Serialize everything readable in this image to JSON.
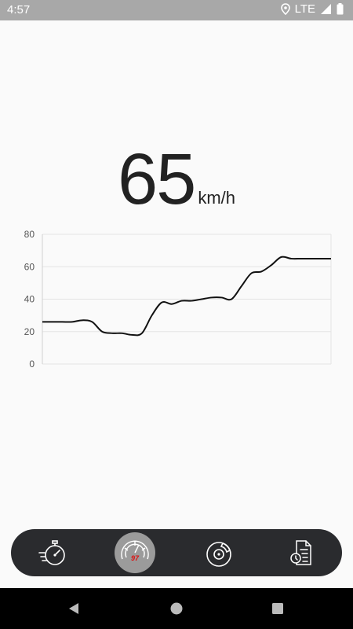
{
  "status_bar": {
    "time": "4:57",
    "network": "LTE"
  },
  "speed": {
    "value": "65",
    "unit": "km/h"
  },
  "chart_data": {
    "type": "line",
    "ylim": [
      0,
      80
    ],
    "yticks": [
      "80",
      "60",
      "40",
      "20",
      "0"
    ],
    "grid": true,
    "series": [
      {
        "values": [
          26,
          26,
          26,
          26,
          27,
          26,
          20,
          19,
          19,
          18,
          19,
          30,
          38,
          37,
          39,
          39,
          40,
          41,
          41,
          40,
          48,
          56,
          57,
          61,
          66,
          65,
          65,
          65,
          65,
          65
        ]
      }
    ],
    "line_color": "#111111"
  },
  "bottom_nav": {
    "gauge_badge": "97",
    "items": [
      "stopwatch-icon",
      "speedometer-icon",
      "brake-disc-icon",
      "history-icon"
    ]
  }
}
